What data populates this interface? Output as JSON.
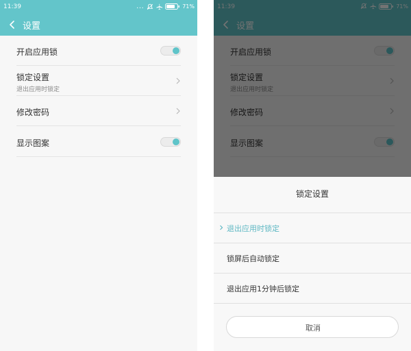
{
  "status_bar": {
    "time": "11:39",
    "left_extra": "...",
    "battery_percent": "71%"
  },
  "app_bar": {
    "title": "设置",
    "color": "#63c5ca"
  },
  "settings": [
    {
      "id": "app-lock",
      "label": "开启应用锁",
      "type": "toggle",
      "on": true
    },
    {
      "id": "lock-settings",
      "label": "锁定设置",
      "sublabel": "退出应用时锁定",
      "type": "chevron"
    },
    {
      "id": "change-password",
      "label": "修改密码",
      "type": "chevron"
    },
    {
      "id": "show-pattern",
      "label": "显示图案",
      "type": "toggle",
      "on": true
    }
  ],
  "sheet": {
    "title": "锁定设置",
    "options": [
      {
        "label": "退出应用时锁定",
        "selected": true
      },
      {
        "label": "锁屏后自动锁定",
        "selected": false
      },
      {
        "label": "退出应用1分钟后锁定",
        "selected": false
      }
    ],
    "cancel_label": "取消",
    "selected_color": "#5fb8c3"
  },
  "colors": {
    "accent": "#5fc4c9"
  },
  "icons": {
    "back": "chevron-left-icon",
    "chevron": "chevron-right-icon",
    "mute": "bell-off-icon",
    "airplane": "airplane-icon",
    "battery": "battery-icon",
    "check": "check-chevron-icon"
  }
}
